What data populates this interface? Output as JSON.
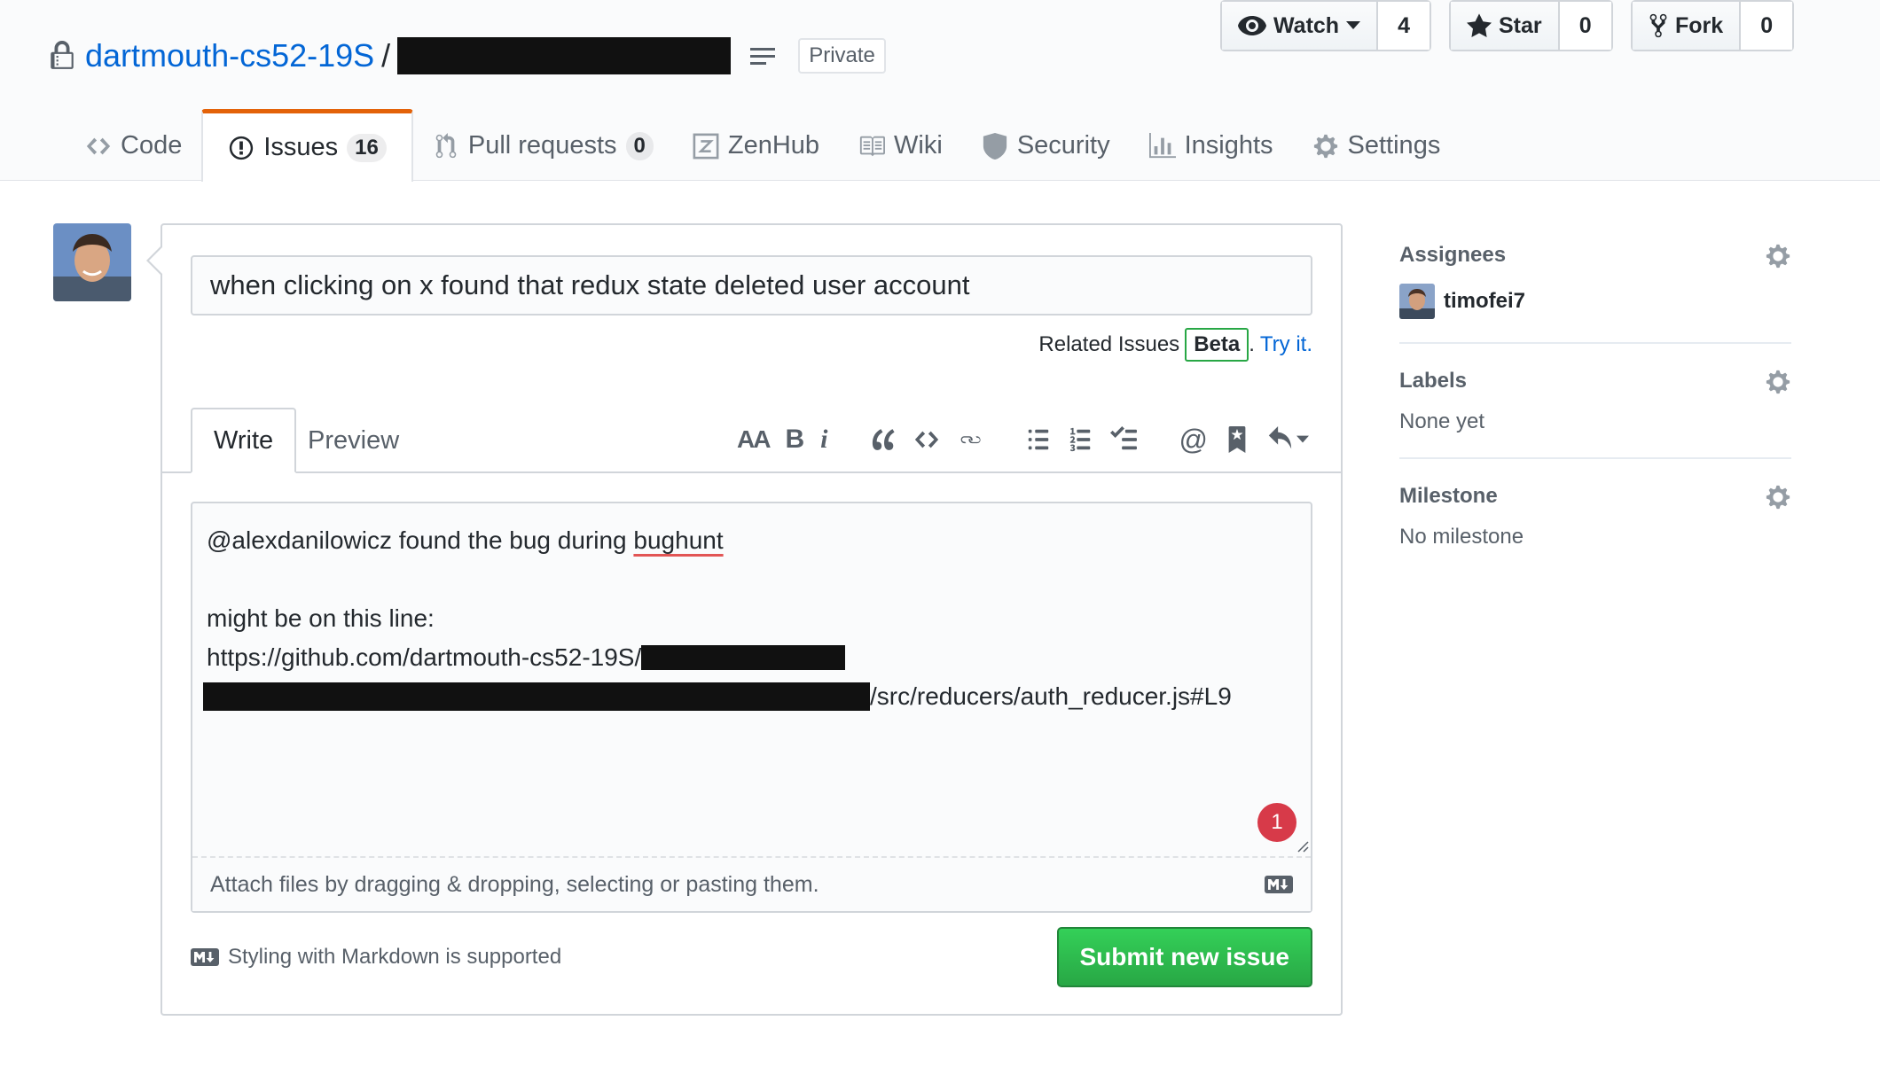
{
  "repo": {
    "owner": "dartmouth-cs52-19S",
    "separator": "/",
    "visibility": "Private"
  },
  "actions": {
    "watch": {
      "label": "Watch",
      "count": "4"
    },
    "star": {
      "label": "Star",
      "count": "0"
    },
    "fork": {
      "label": "Fork",
      "count": "0"
    }
  },
  "tabs": {
    "code": "Code",
    "issues": "Issues",
    "issues_count": "16",
    "pulls": "Pull requests",
    "pulls_count": "0",
    "zenhub": "ZenHub",
    "wiki": "Wiki",
    "security": "Security",
    "insights": "Insights",
    "settings": "Settings"
  },
  "issue_form": {
    "title_value": "when clicking on x found that redux state deleted user account",
    "related_label": "Related Issues",
    "beta_label": "Beta",
    "dot": ".",
    "try_label": "Try it.",
    "write_tab": "Write",
    "preview_tab": "Preview",
    "body": {
      "mention_line_prefix": "@alexdanilowicz found the bug during ",
      "mention_line_word": "bughunt",
      "line2": "might be on this line:",
      "url_prefix": "https://github.com/dartmouth-cs52-19S/",
      "url_suffix": "/src/reducers/auth_reducer.js#L9"
    },
    "notification_count": "1",
    "attach_text": "Attach files by dragging & dropping, selecting or pasting them.",
    "markdown_note": "Styling with Markdown is supported",
    "submit_label": "Submit new issue"
  },
  "sidebar": {
    "assignees_label": "Assignees",
    "assignee_name": "timofei7",
    "labels_label": "Labels",
    "labels_value": "None yet",
    "milestone_label": "Milestone",
    "milestone_value": "No milestone"
  },
  "colors": {
    "link": "#0366d6",
    "selected_tab_accent": "#e36209",
    "submit_green": "#28a745",
    "notification_red": "#d73a49"
  }
}
